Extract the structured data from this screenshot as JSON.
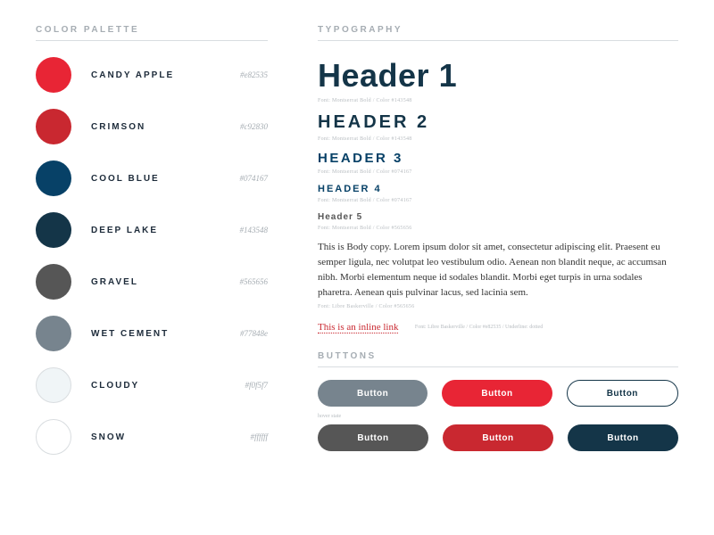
{
  "palette": {
    "title": "COLOR PALETTE",
    "swatches": [
      {
        "name": "CANDY APPLE",
        "hex": "#e82535"
      },
      {
        "name": "CRIMSON",
        "hex": "#c92830"
      },
      {
        "name": "COOL BLUE",
        "hex": "#074167"
      },
      {
        "name": "DEEP LAKE",
        "hex": "#143548"
      },
      {
        "name": "GRAVEL",
        "hex": "#565656"
      },
      {
        "name": "WET CEMENT",
        "hex": "#77848e"
      },
      {
        "name": "CLOUDY",
        "hex": "#f0f5f7"
      },
      {
        "name": "SNOW",
        "hex": "#ffffff"
      }
    ]
  },
  "typography": {
    "title": "TYPOGRAPHY",
    "samples": [
      {
        "label": "Header 1",
        "meta": "Font: Montserrat Bold / Color #143548"
      },
      {
        "label": "HEADER 2",
        "meta": "Font: Montserrat Bold / Color #143548"
      },
      {
        "label": "HEADER 3",
        "meta": "Font: Montserrat Bold / Color #074167"
      },
      {
        "label": "HEADER 4",
        "meta": "Font: Montserrat Bold / Color #074167"
      },
      {
        "label": "Header 5",
        "meta": "Font: Montserrat Bold / Color #565656"
      }
    ],
    "body": "This is Body copy. Lorem ipsum dolor sit amet, consectetur adipiscing elit. Praesent eu semper ligula, nec volutpat leo vestibulum odio. Aenean non blandit neque, ac accumsan nibh. Morbi elementum neque id sodales blandit. Morbi eget turpis in urna sodales pharetra. Aenean quis pulvinar lacus, sed lacinia sem.",
    "body_meta": "Font: Libre Baskerville / Color #565656",
    "link_text": "This is an inline link",
    "link_meta": "Font: Libre Baskerville / Color #e82535 / Underline: dotted"
  },
  "buttons": {
    "title": "BUTTONS",
    "label": "Button",
    "hover_state_label": "hover state"
  }
}
